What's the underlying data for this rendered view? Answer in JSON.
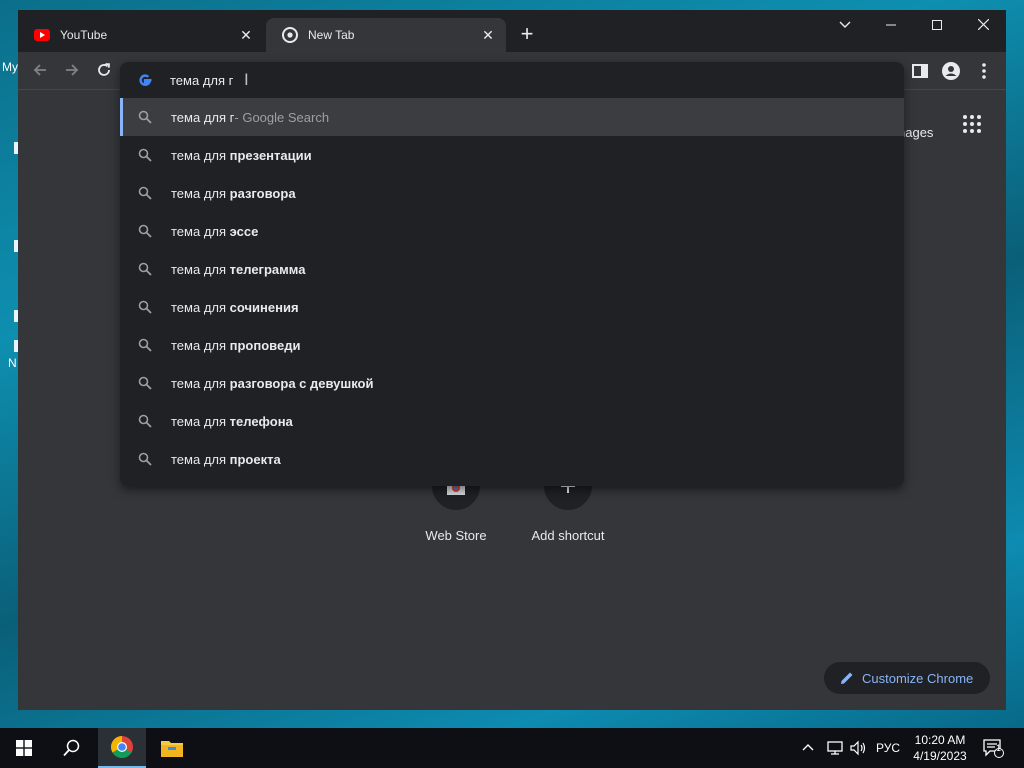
{
  "desktop": {
    "frag1": "My",
    "frag2": "N"
  },
  "tabs": [
    {
      "title": "YouTube",
      "icon": "youtube-icon"
    },
    {
      "title": "New Tab",
      "icon": "chrome-icon"
    }
  ],
  "omnibox": {
    "value": "тема для г",
    "top": {
      "prefix": "тема для г",
      "suffix": " - Google Search"
    },
    "suggestions": [
      {
        "prefix": "тема для ",
        "bold": "презентации"
      },
      {
        "prefix": "тема для ",
        "bold": "разговора"
      },
      {
        "prefix": "тема для ",
        "bold": "эссе"
      },
      {
        "prefix": "тема для ",
        "bold": "телеграмма"
      },
      {
        "prefix": "тема для ",
        "bold": "сочинения"
      },
      {
        "prefix": "тема для ",
        "bold": "проповеди"
      },
      {
        "prefix": "тема для ",
        "bold": "разговора с девушкой"
      },
      {
        "prefix": "тема для ",
        "bold": "телефона"
      },
      {
        "prefix": "тема для ",
        "bold": "проекта"
      }
    ]
  },
  "page": {
    "images_link": "nages",
    "shortcuts": [
      {
        "label": "Web Store"
      },
      {
        "label": "Add shortcut"
      }
    ],
    "customize_label": "Customize Chrome"
  },
  "taskbar": {
    "lang": "РУС",
    "time": "10:20 AM",
    "date": "4/19/2023",
    "notif_count": "1"
  },
  "colors": {
    "accent": "#8ab4f8",
    "bg": "#35363a",
    "popup": "#202124"
  }
}
